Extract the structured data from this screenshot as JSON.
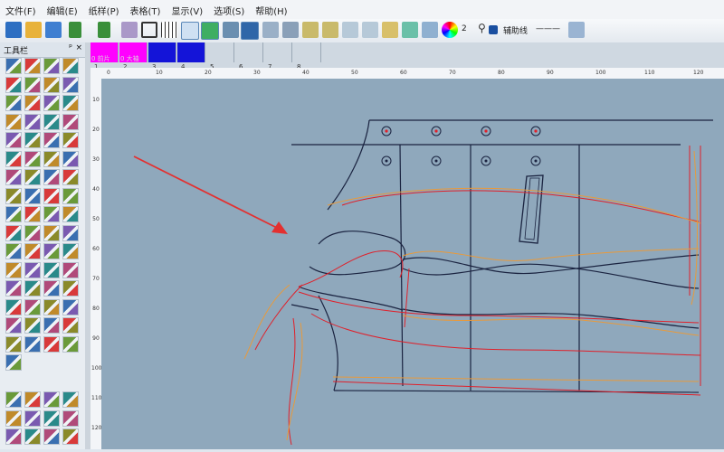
{
  "menu": [
    "文件(F)",
    "编辑(E)",
    "纸样(P)",
    "表格(T)",
    "显示(V)",
    "选项(S)",
    "帮助(H)"
  ],
  "toolbar": {
    "layer_number": "2",
    "aux_line_label": "辅助线",
    "line_style": "———"
  },
  "panel": {
    "title": "工具栏",
    "pin": "ᵖ",
    "close": "×"
  },
  "pieces": [
    {
      "label": "0 前片",
      "number": "1"
    },
    {
      "label": "0 大袖",
      "number": "2"
    },
    {
      "label": "",
      "number": "3"
    },
    {
      "label": "",
      "number": "4"
    },
    {
      "label": "",
      "number": "5"
    },
    {
      "label": "",
      "number": "6"
    },
    {
      "label": "",
      "number": "7"
    },
    {
      "label": "",
      "number": "8"
    }
  ],
  "ruler_h": [
    "0",
    "10",
    "20",
    "30",
    "40",
    "50",
    "60",
    "70",
    "80",
    "90",
    "100",
    "110",
    "120"
  ],
  "ruler_v": [
    "10",
    "20",
    "30",
    "40",
    "50",
    "60",
    "70",
    "80",
    "90",
    "100",
    "110",
    "120"
  ],
  "colors": {
    "accent": "#3b6ea5",
    "pattern_red": "#e0202a",
    "pattern_orange": "#e89a3c",
    "pattern_navy": "#14234a",
    "canvas": "#8fa8bc",
    "magenta": "#ff00ff",
    "blue": "#1414d8"
  }
}
